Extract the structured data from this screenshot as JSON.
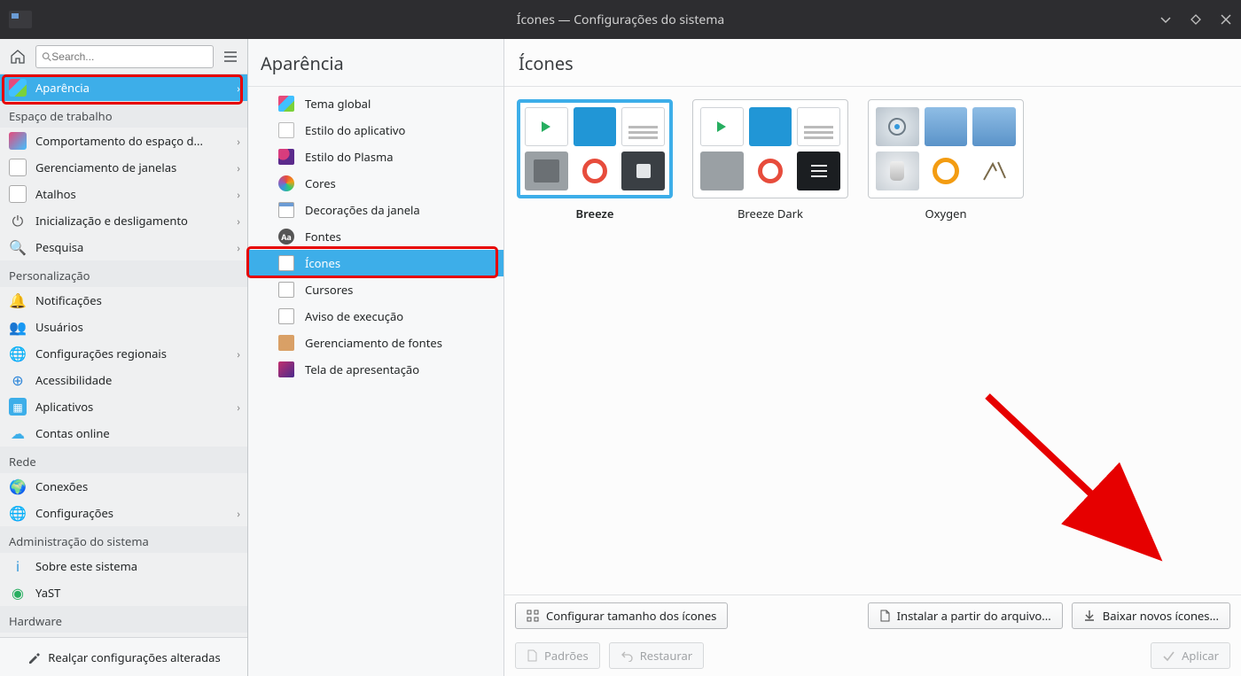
{
  "window": {
    "title": "Ícones — Configurações do sistema"
  },
  "sidebar1": {
    "search_placeholder": "Search...",
    "footer": "Realçar configurações alteradas",
    "groups": [
      {
        "items": [
          {
            "label": "Aparência",
            "chev": true,
            "selected": true,
            "icon": "ic-color"
          }
        ]
      },
      {
        "header": "Espaço de trabalho",
        "items": [
          {
            "label": "Comportamento do espaço d...",
            "chev": true,
            "icon": "ic-behavior"
          },
          {
            "label": "Gerenciamento de janelas",
            "chev": true,
            "icon": "ic-winmgr"
          },
          {
            "label": "Atalhos",
            "chev": true,
            "icon": "ic-short"
          },
          {
            "label": "Inicialização e desligamento",
            "chev": true,
            "icon": "ic-power"
          },
          {
            "label": "Pesquisa",
            "chev": true,
            "icon": "ic-search"
          }
        ]
      },
      {
        "header": "Personalização",
        "items": [
          {
            "label": "Notificações",
            "icon": "ic-bell"
          },
          {
            "label": "Usuários",
            "icon": "ic-users"
          },
          {
            "label": "Configurações regionais",
            "chev": true,
            "icon": "ic-globe"
          },
          {
            "label": "Acessibilidade",
            "icon": "ic-shield"
          },
          {
            "label": "Aplicativos",
            "chev": true,
            "icon": "ic-apps"
          },
          {
            "label": "Contas online",
            "icon": "ic-cloud"
          }
        ]
      },
      {
        "header": "Rede",
        "items": [
          {
            "label": "Conexões",
            "icon": "ic-net"
          },
          {
            "label": "Configurações",
            "chev": true,
            "icon": "ic-globe"
          }
        ]
      },
      {
        "header": "Administração do sistema",
        "items": [
          {
            "label": "Sobre este sistema",
            "icon": "ic-info"
          },
          {
            "label": "YaST",
            "icon": "ic-yast"
          }
        ]
      },
      {
        "header": "Hardware",
        "items": []
      }
    ]
  },
  "sidebar2": {
    "title": "Aparência",
    "items": [
      {
        "label": "Tema global",
        "icon": "ic-color"
      },
      {
        "label": "Estilo do aplicativo",
        "icon": "ic-app"
      },
      {
        "label": "Estilo do Plasma",
        "icon": "ic-plasma"
      },
      {
        "label": "Cores",
        "icon": "ic-palette"
      },
      {
        "label": "Decorações da janela",
        "icon": "ic-window"
      },
      {
        "label": "Fontes",
        "icon": "ic-font",
        "txt": "Aa"
      },
      {
        "label": "Ícones",
        "icon": "ic-grid",
        "selected": true
      },
      {
        "label": "Cursores",
        "icon": "ic-cursor"
      },
      {
        "label": "Aviso de execução",
        "icon": "ic-exec"
      },
      {
        "label": "Gerenciamento de fontes",
        "icon": "ic-fontmgr"
      },
      {
        "label": "Tela de apresentação",
        "icon": "ic-splash"
      }
    ]
  },
  "main": {
    "title": "Ícones",
    "themes": [
      {
        "name": "Breeze",
        "selected": true,
        "variant": "light"
      },
      {
        "name": "Breeze Dark",
        "variant": "dark"
      },
      {
        "name": "Oxygen",
        "variant": "oxygen"
      }
    ],
    "buttons": {
      "configure_sizes": "Configurar tamanho dos ícones",
      "install_file": "Instalar a partir do arquivo...",
      "download_new": "Baixar novos ícones...",
      "defaults": "Padrões",
      "restore": "Restaurar",
      "apply": "Aplicar"
    }
  }
}
